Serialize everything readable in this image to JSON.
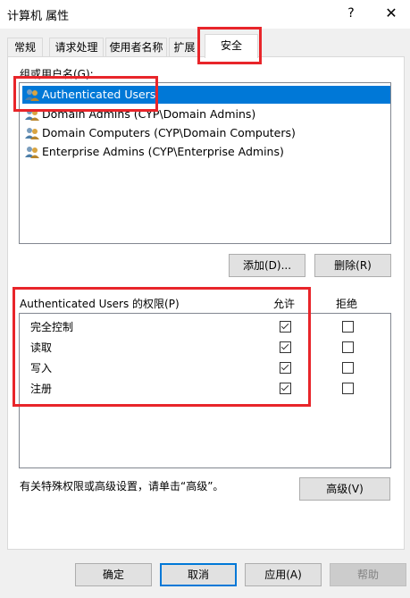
{
  "window": {
    "title": "计算机 属性",
    "help_glyph": "?",
    "close_glyph": "✕"
  },
  "tabs": [
    {
      "label": "常规"
    },
    {
      "label": "请求处理"
    },
    {
      "label": "使用者名称"
    },
    {
      "label": "扩展"
    },
    {
      "label": "安全",
      "active": true
    }
  ],
  "users": {
    "label": "组或用户名(G):",
    "items": [
      {
        "name": "Authenticated Users",
        "selected": true,
        "icon": "users-group-icon"
      },
      {
        "name": "Domain Admins (CYP\\Domain Admins)",
        "selected": false,
        "icon": "users-group-icon"
      },
      {
        "name": "Domain Computers (CYP\\Domain Computers)",
        "selected": false,
        "icon": "users-group-icon"
      },
      {
        "name": "Enterprise Admins (CYP\\Enterprise Admins)",
        "selected": false,
        "icon": "users-group-icon"
      }
    ],
    "add_label": "添加(D)...",
    "remove_label": "删除(R)"
  },
  "permissions": {
    "header": "Authenticated Users 的权限(P)",
    "allow_header": "允许",
    "deny_header": "拒绝",
    "rows": [
      {
        "name": "完全控制",
        "allow": true,
        "deny": false
      },
      {
        "name": "读取",
        "allow": true,
        "deny": false
      },
      {
        "name": "写入",
        "allow": true,
        "deny": false
      },
      {
        "name": "注册",
        "allow": true,
        "deny": false
      }
    ]
  },
  "advanced": {
    "note": "有关特殊权限或高级设置，请单击“高级”。",
    "button_label": "高级(V)"
  },
  "footer": {
    "ok_label": "确定",
    "cancel_label": "取消",
    "apply_label": "应用(A)",
    "help_label": "帮助"
  },
  "colors": {
    "selection": "#0078d7",
    "highlight_box": "#e8252a"
  }
}
